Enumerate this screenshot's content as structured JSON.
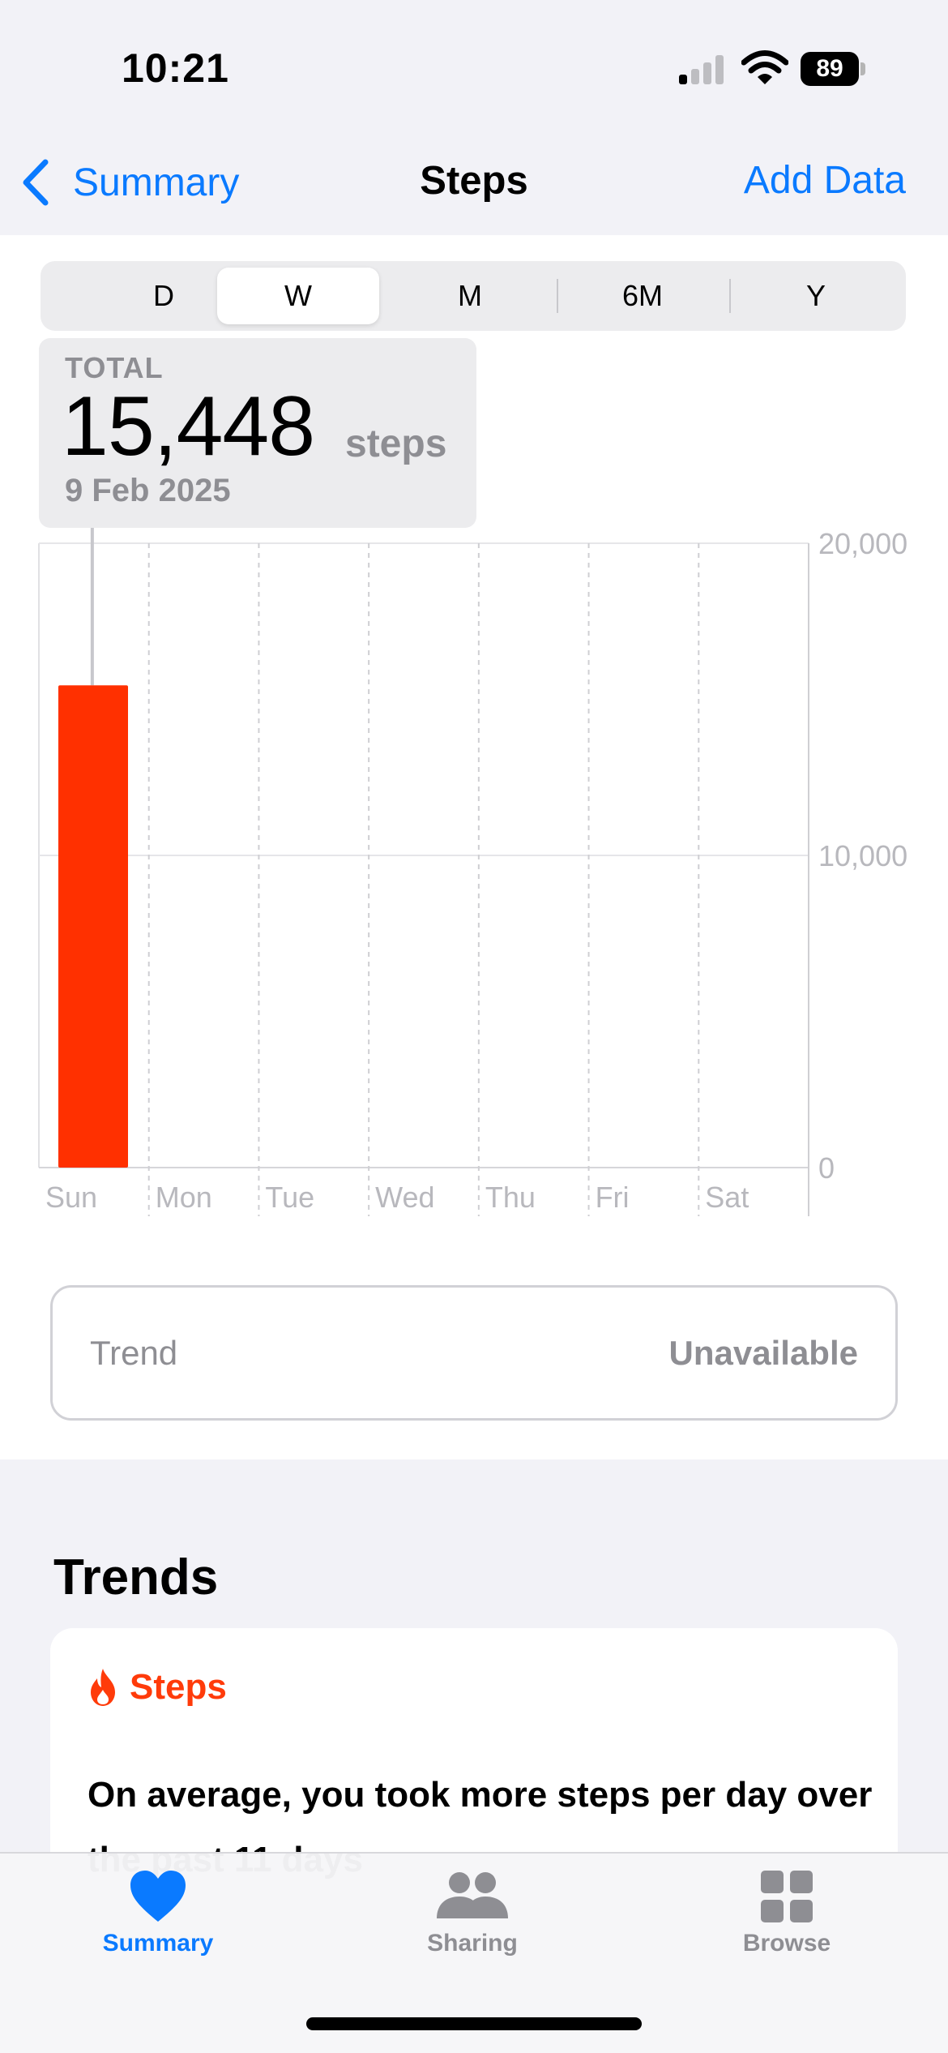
{
  "status_bar": {
    "time": "10:21",
    "battery": "89",
    "icons": [
      "cellular-signal-icon",
      "wifi-icon",
      "battery-icon"
    ]
  },
  "nav": {
    "back_label": "Summary",
    "title": "Steps",
    "action_label": "Add Data",
    "accent_color": "#0a7aff"
  },
  "range_selector": {
    "options": [
      "D",
      "W",
      "M",
      "6M",
      "Y"
    ],
    "selected": "W"
  },
  "selection": {
    "label": "TOTAL",
    "value": "15,448",
    "unit": "steps",
    "date": "9 Feb 2025"
  },
  "chart_data": {
    "type": "bar",
    "categories": [
      "Sun",
      "Mon",
      "Tue",
      "Wed",
      "Thu",
      "Fri",
      "Sat"
    ],
    "values": [
      15448,
      0,
      0,
      0,
      0,
      0,
      0
    ],
    "ylim": [
      0,
      20000
    ],
    "yticks": [
      "20,000",
      "10,000",
      "0"
    ],
    "ytick_values": [
      20000,
      10000,
      0
    ],
    "bar_color": "#ff3000",
    "grid": true,
    "selected_index": 0
  },
  "trend_card": {
    "label": "Trend",
    "value": "Unavailable"
  },
  "trends": {
    "heading": "Trends",
    "tag": "Steps",
    "tag_icon": "flame-icon",
    "tag_color": "#ff3b0a",
    "text": "On average, you took more steps per day over the past 11 days"
  },
  "tab_bar": {
    "tabs": [
      {
        "label": "Summary",
        "icon": "heart-icon",
        "active": true
      },
      {
        "label": "Sharing",
        "icon": "people-icon",
        "active": false
      },
      {
        "label": "Browse",
        "icon": "grid-icon",
        "active": false
      }
    ],
    "active_color": "#0a7aff",
    "inactive_color": "#8e8e93"
  }
}
